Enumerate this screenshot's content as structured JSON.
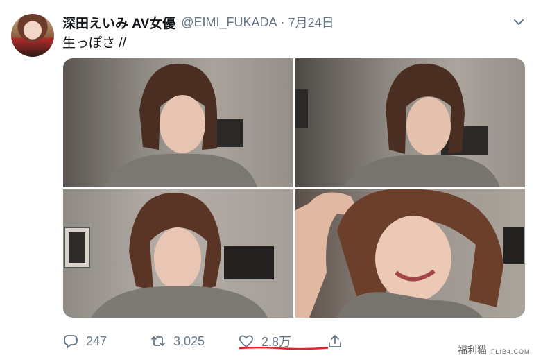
{
  "tweet": {
    "display_name": "深田えいみ AV女優",
    "handle": "@EIMI_FUKADA",
    "separator": "·",
    "date": "7月24日",
    "text": "生っぽさ //"
  },
  "actions": {
    "replies": "247",
    "retweets": "3,025",
    "likes": "2.8万"
  },
  "watermark": {
    "label": "福利猫",
    "site": "FLIB4.COM"
  },
  "colors": {
    "text": "#14171a",
    "secondary": "#657786",
    "underline": "#e0262b"
  }
}
